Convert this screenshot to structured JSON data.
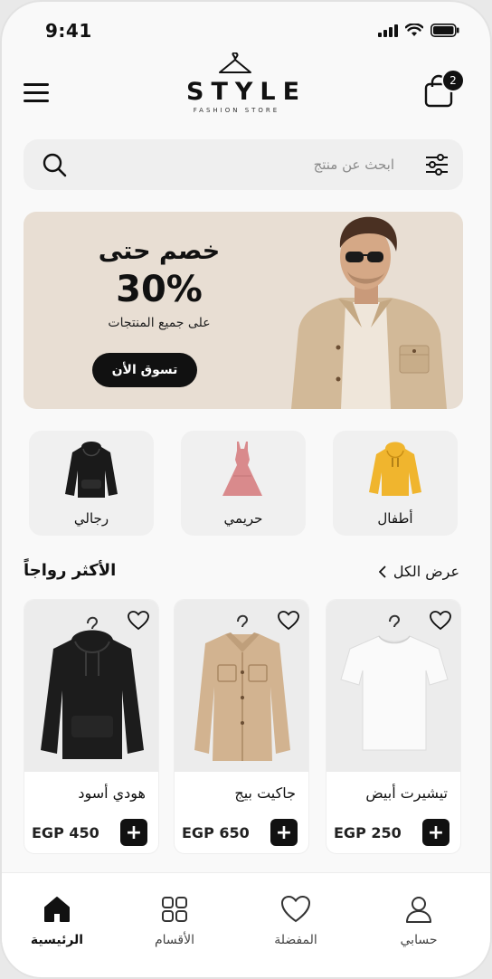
{
  "status_bar": {
    "time": "9:41"
  },
  "header": {
    "brand": "STYLE",
    "subtitle": "FASHION STORE",
    "cart_count": "2"
  },
  "search": {
    "placeholder": "ابحث عن منتج"
  },
  "banner": {
    "title": "خصم حتى",
    "percent": "30%",
    "subtitle": "على جميع المنتجات",
    "button": "تسوق الأن",
    "background": "#e8ded3"
  },
  "categories": [
    {
      "label": "أطفال",
      "icon": "yellow-hoodie-icon",
      "color": "#f0b52e"
    },
    {
      "label": "حريمي",
      "icon": "pink-dress-icon",
      "color": "#d98a8c"
    },
    {
      "label": "رجالي",
      "icon": "black-hoodie-icon",
      "color": "#1a1a1a"
    }
  ],
  "section": {
    "title": "الأكثر رواجاً",
    "view_all": "عرض الكل"
  },
  "products": [
    {
      "name": "تيشيرت أبيض",
      "price": "EGP 250",
      "icon": "white-tshirt"
    },
    {
      "name": "جاكيت بيج",
      "price": "EGP 650",
      "icon": "beige-jacket"
    },
    {
      "name": "هودي أسود",
      "price": "EGP 450",
      "icon": "black-hoodie"
    }
  ],
  "bottom_nav": [
    {
      "label": "حسابي",
      "icon": "user-icon",
      "active": false
    },
    {
      "label": "المفضلة",
      "icon": "heart-icon",
      "active": false
    },
    {
      "label": "الأقسام",
      "icon": "grid-icon",
      "active": false
    },
    {
      "label": "الرئيسية",
      "icon": "home-icon",
      "active": true
    }
  ],
  "colors": {
    "accent": "#111111",
    "background": "#f9f9f9",
    "card": "#ffffff"
  }
}
